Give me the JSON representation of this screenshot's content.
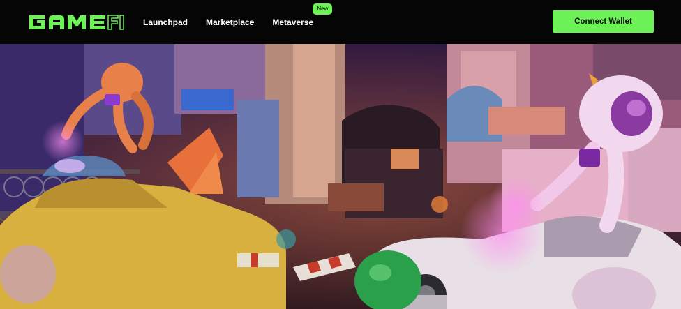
{
  "brand": {
    "logo_text": "GAMEFI"
  },
  "nav": {
    "items": [
      {
        "label": "Launchpad"
      },
      {
        "label": "Marketplace"
      },
      {
        "label": "Metaverse",
        "badge": "New"
      }
    ]
  },
  "header": {
    "connect_label": "Connect Wallet"
  },
  "colors": {
    "accent": "#6cf256",
    "background": "#050505",
    "text": "#ffffff"
  }
}
